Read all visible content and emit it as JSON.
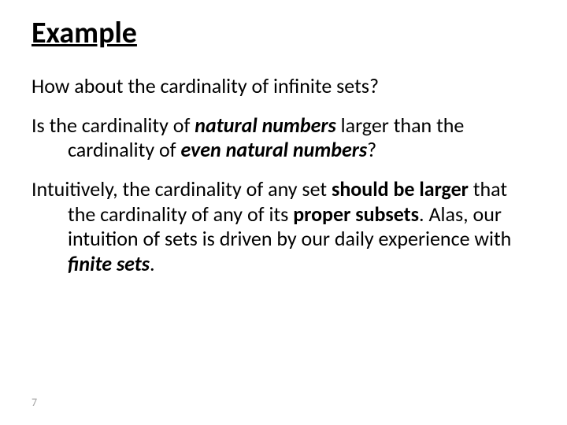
{
  "title": "Example",
  "p1": "How about the cardinality of infinite sets?",
  "p2": {
    "t1": "Is the cardinality of ",
    "t2": "natural numbers",
    "t3": " larger than the cardinality of ",
    "t4": "even natural numbers",
    "t5": "?"
  },
  "p3": {
    "t1": "Intuitively, the cardinality of any set ",
    "t2": "should be larger",
    "t3": " that the cardinality of any of its ",
    "t4": "proper subsets",
    "t5": ". Alas, our intuition of sets is driven by our daily experience with ",
    "t6": "finite sets",
    "t7": "."
  },
  "page_number": "7"
}
